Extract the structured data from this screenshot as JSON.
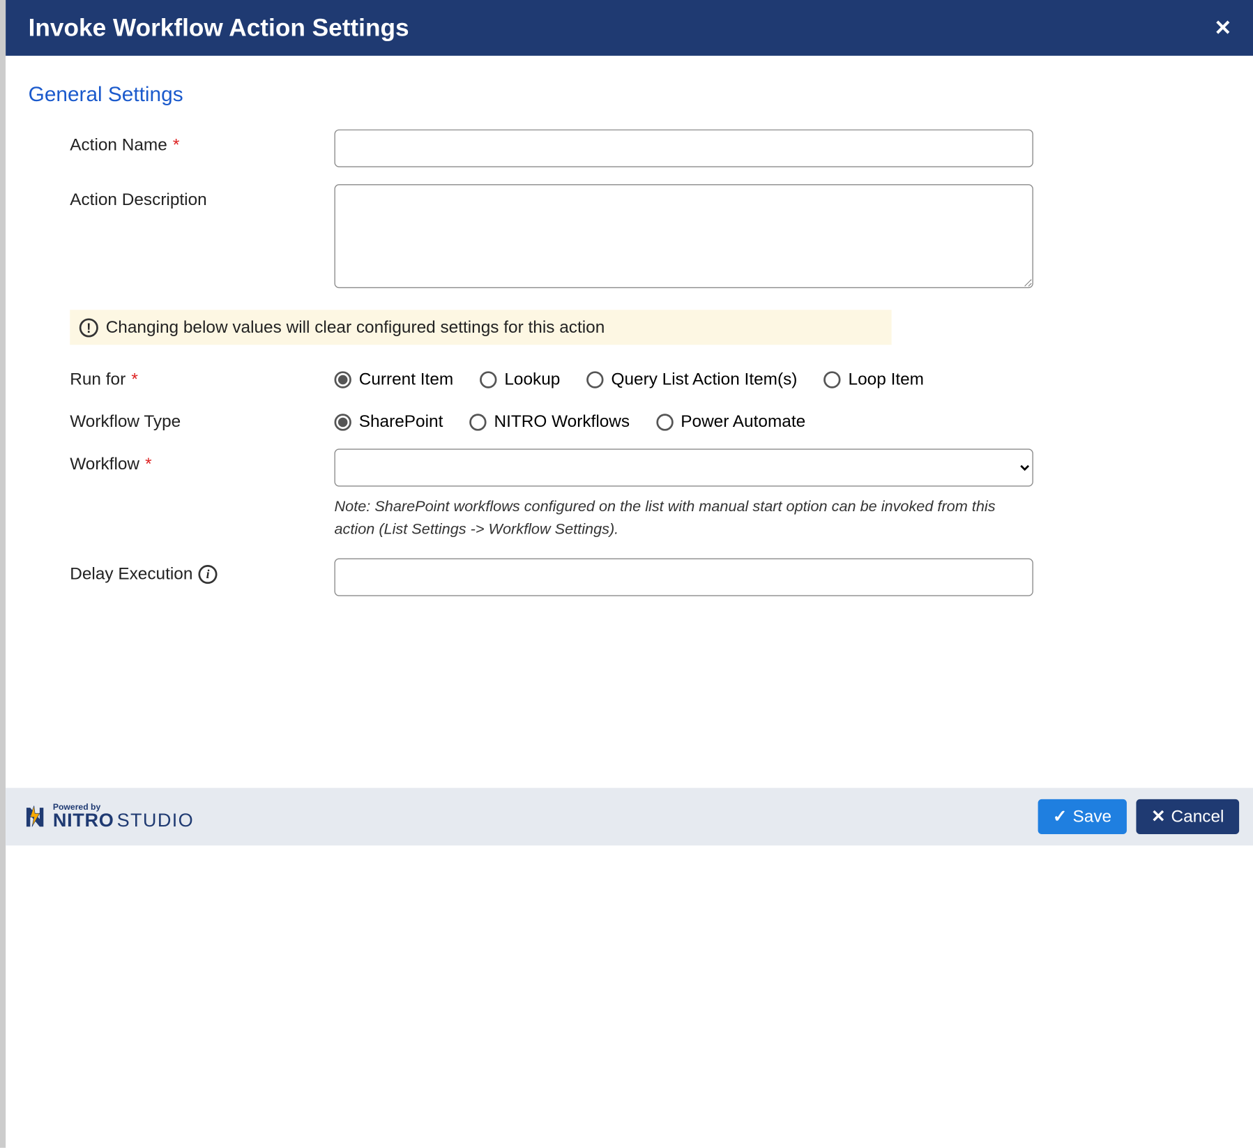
{
  "header": {
    "title": "Invoke Workflow Action Settings"
  },
  "section": {
    "title": "General Settings"
  },
  "fields": {
    "action_name": {
      "label": "Action Name",
      "required": true,
      "value": ""
    },
    "action_description": {
      "label": "Action Description",
      "value": ""
    },
    "warning": "Changing below values will clear configured settings for this action",
    "run_for": {
      "label": "Run for",
      "required": true,
      "selected": "Current Item",
      "options": [
        "Current Item",
        "Lookup",
        "Query List Action Item(s)",
        "Loop Item"
      ]
    },
    "workflow_type": {
      "label": "Workflow Type",
      "selected": "SharePoint",
      "options": [
        "SharePoint",
        "NITRO Workflows",
        "Power Automate"
      ]
    },
    "workflow": {
      "label": "Workflow",
      "required": true,
      "value": "",
      "note": "Note: SharePoint workflows configured on the list with manual start option can be invoked from this action (List Settings -> Workflow Settings)."
    },
    "delay_execution": {
      "label": "Delay Execution",
      "value": ""
    }
  },
  "footer": {
    "brand": {
      "powered_by": "Powered by",
      "name": "NITRO",
      "studio": "STUDIO"
    },
    "save_label": "Save",
    "cancel_label": "Cancel"
  }
}
